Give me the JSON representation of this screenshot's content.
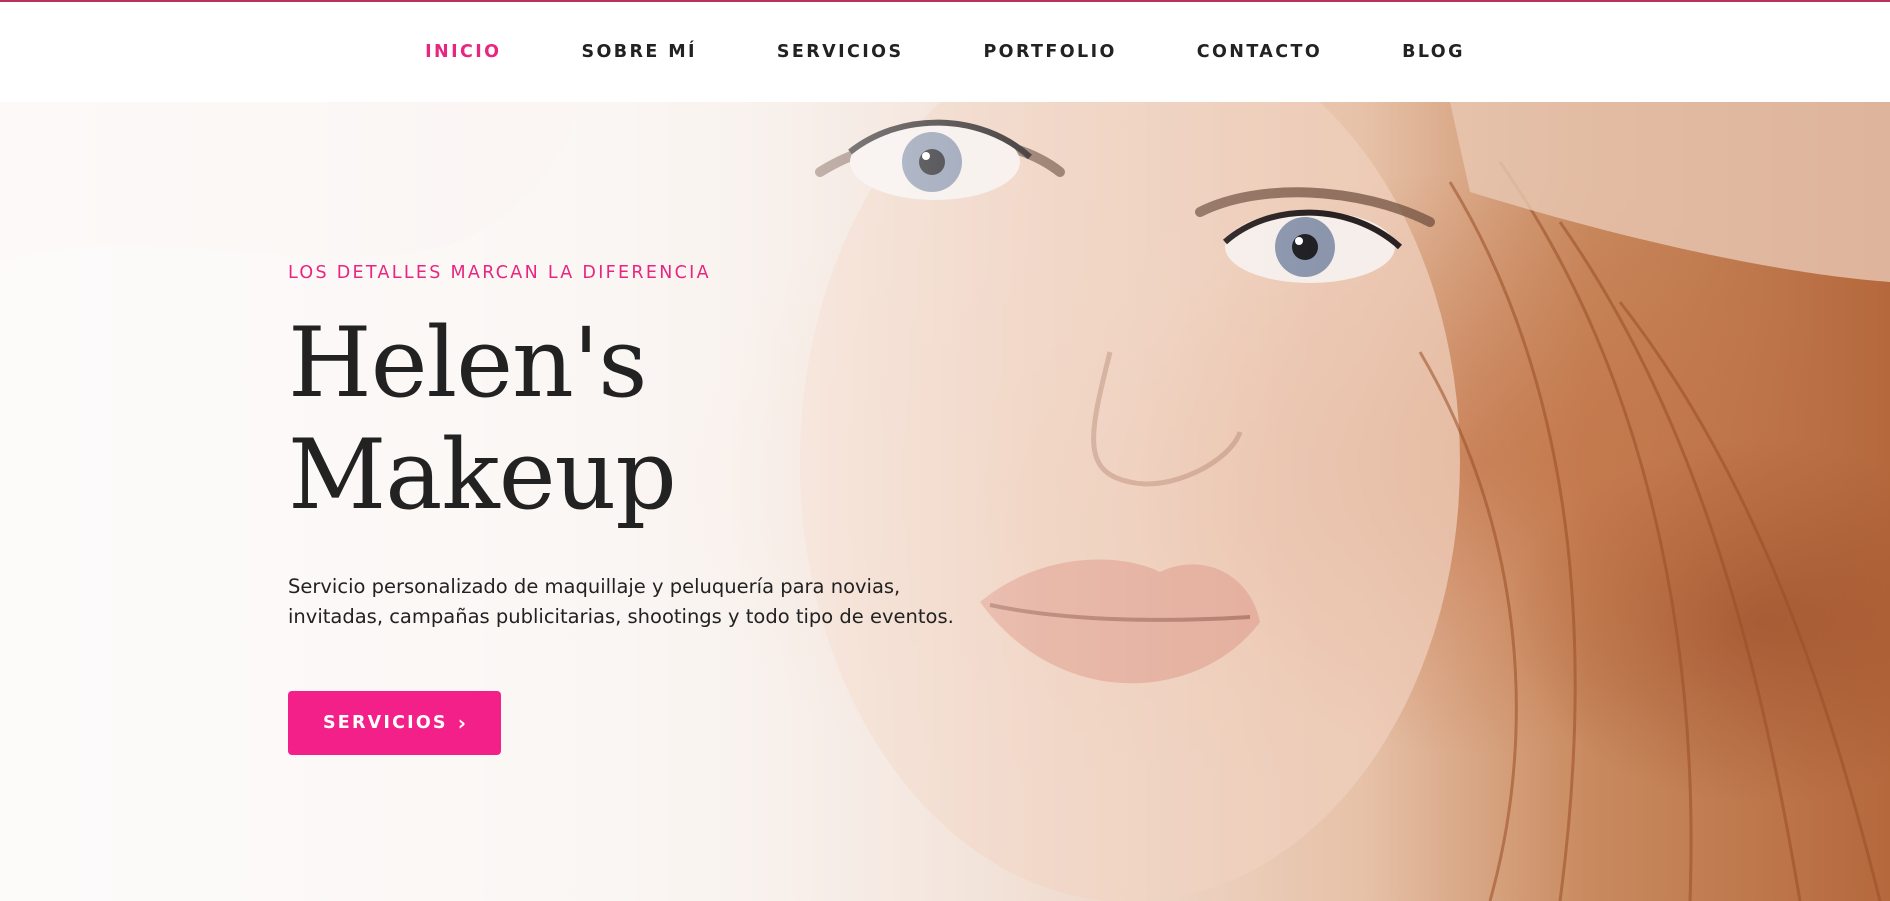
{
  "nav": {
    "items": [
      {
        "label": "INICIO",
        "active": true
      },
      {
        "label": "SOBRE MÍ",
        "active": false
      },
      {
        "label": "SERVICIOS",
        "active": false
      },
      {
        "label": "PORTFOLIO",
        "active": false
      },
      {
        "label": "CONTACTO",
        "active": false
      },
      {
        "label": "BLOG",
        "active": false
      }
    ]
  },
  "hero": {
    "kicker": "LOS DETALLES MARCAN LA DIFERENCIA",
    "title_line1": "Helen's",
    "title_line2": "Makeup",
    "description": "Servicio personalizado de maquillaje y peluquería para novias, invitadas, campañas publicitarias, shootings y todo tipo de eventos.",
    "cta_label": "SERVICIOS",
    "cta_icon": "chevron-right-icon"
  },
  "colors": {
    "accent": "#e8257f",
    "button": "#f4208a",
    "text": "#222222",
    "top_border": "#b8325e"
  }
}
